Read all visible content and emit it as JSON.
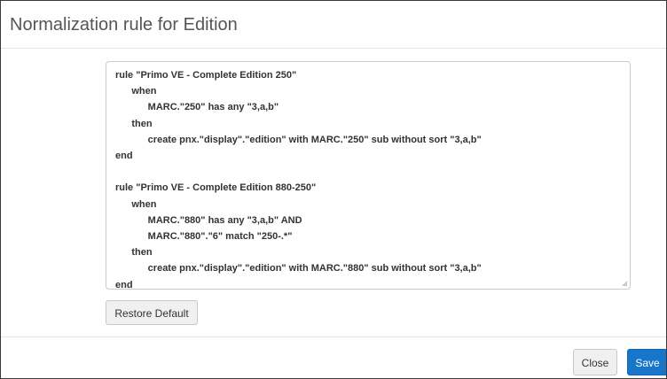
{
  "dialog": {
    "title": "Normalization rule for Edition"
  },
  "editor": {
    "content": "rule \"Primo VE - Complete Edition 250\"\n      when\n            MARC.\"250\" has any \"3,a,b\"\n      then\n            create pnx.\"display\".\"edition\" with MARC.\"250\" sub without sort \"3,a,b\"\nend\n\nrule \"Primo VE - Complete Edition 880-250\"\n      when\n            MARC.\"880\" has any \"3,a,b\" AND\n            MARC.\"880\".\"6\" match \"250-.*\"\n      then\n            create pnx.\"display\".\"edition\" with MARC.\"880\" sub without sort \"3,a,b\"\nend"
  },
  "buttons": {
    "restore_default": "Restore Default",
    "close": "Close",
    "save": "Save"
  },
  "colors": {
    "primary": "#1776c9",
    "title_text": "#555555",
    "default_button_bg": "#f0f0f0"
  },
  "icons": {
    "resize_grip": "resize-grip-icon"
  }
}
